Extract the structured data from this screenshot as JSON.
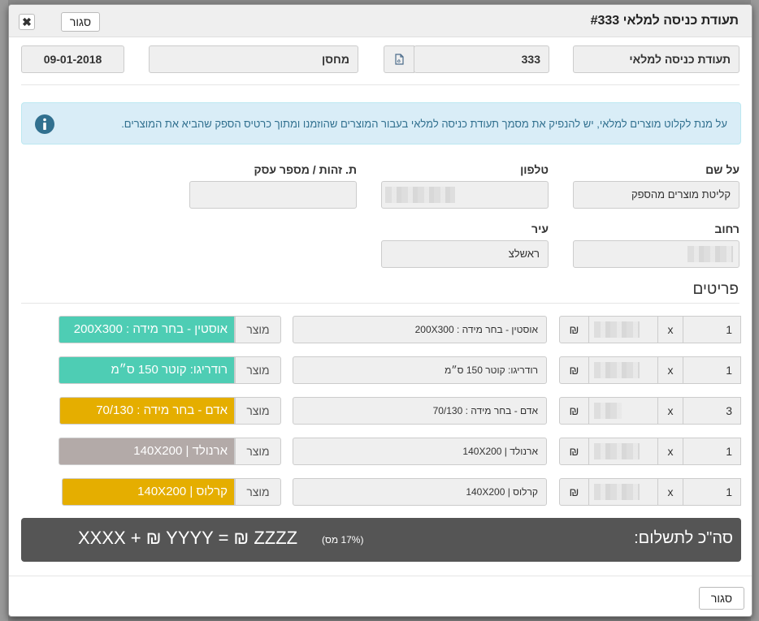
{
  "header": {
    "title": "תעודת כניסה למלאי #333",
    "close_label": "סגור",
    "x_label": "✖"
  },
  "doc": {
    "type_value": "תעודת כניסה למלאי",
    "number_value": "333",
    "warehouse_value": "מחסן",
    "date_value": "09-01-2018"
  },
  "alert": {
    "text": "על מנת לקלוט מוצרים למלאי, יש להנפיק את מסמך תעודת כניסה למלאי בעבור המוצרים שהוזמנו ומתוך כרטיס הספק שהביא את המוצרים."
  },
  "customer": {
    "name_label": "על שם",
    "name_value": "קליטת מוצרים מהספק",
    "phone_label": "טלפון",
    "id_label": "ת. זהות / מספר עסק",
    "street_label": "רחוב",
    "city_label": "עיר",
    "city_value": "ראשלצ"
  },
  "items_title": "פריטים",
  "item_ui": {
    "x": "x",
    "currency": "₪",
    "product_label": "מוצר"
  },
  "items": [
    {
      "qty": "1",
      "desc": "אוסטין - בחר מידה : 200X300",
      "product": "אוסטין - בחר מידה : 200X300",
      "color": "#4ecdb4",
      "text_color": "#ffffff"
    },
    {
      "qty": "1",
      "desc": "רודריגו: קוטר 150 ס״מ",
      "product": "רודריגו: קוטר 150 ס״מ",
      "color": "#4ecdb4",
      "text_color": "#ffffff"
    },
    {
      "qty": "3",
      "desc": "אדם - בחר מידה : 70/130",
      "product": "אדם - בחר מידה : 70/130",
      "color": "#e5ae00",
      "text_color": "#ffffff"
    },
    {
      "qty": "1",
      "desc": "ארנולד | 140X200",
      "product": "ארנולד | 140X200",
      "color": "#b3aaa8",
      "text_color": "#ffffff"
    },
    {
      "qty": "1",
      "desc": "קרלוס | 140X200",
      "product": "קרלוס | 140X200",
      "color": "#e5ae00",
      "text_color": "#ffffff"
    }
  ],
  "total": {
    "label": "סה\"כ לתשלום:",
    "expression": "XXXX + ₪ YYYY  =  ₪ ZZZZ",
    "vat_note": "(17% מס)"
  },
  "footer": {
    "close_label": "סגור"
  },
  "icons": {
    "pdf": "pdf-icon",
    "info": "info-circle-icon",
    "close": "close-icon"
  },
  "colors": {
    "alert_bg": "#d9edf7",
    "alert_text": "#31708f",
    "total_bg": "#555555"
  }
}
